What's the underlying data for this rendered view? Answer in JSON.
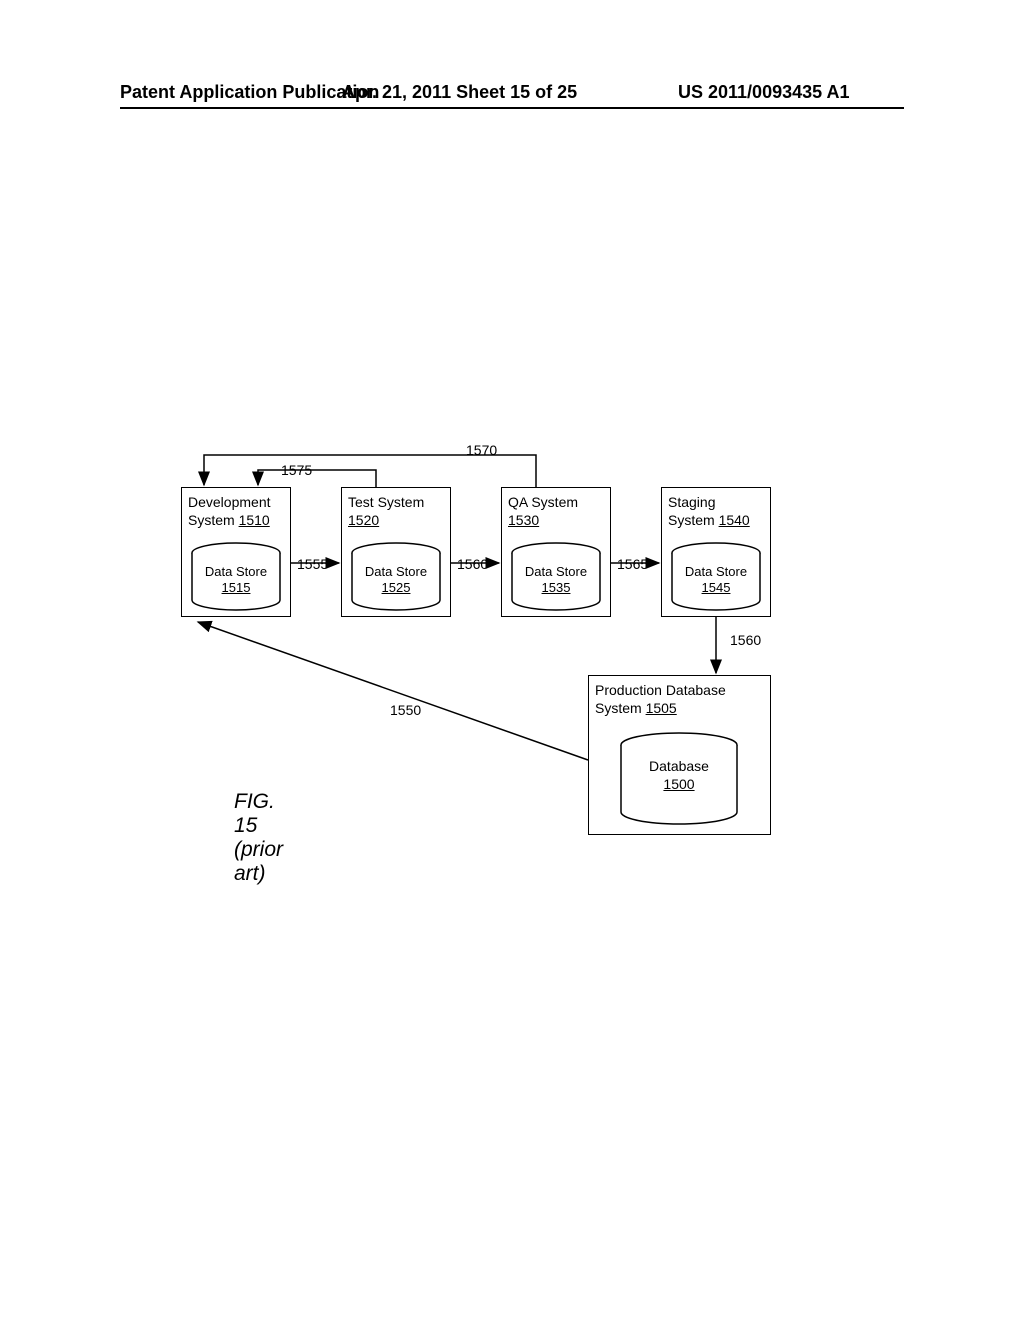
{
  "header": {
    "left": "Patent Application Publication",
    "mid": "Apr. 21, 2011  Sheet 15 of 25",
    "right": "US 2011/0093435 A1"
  },
  "systems": {
    "dev": {
      "line1": "Development",
      "line2": "System ",
      "ref": "1510"
    },
    "test": {
      "line1": "Test System",
      "line2": "",
      "ref": "1520"
    },
    "qa": {
      "line1": "QA System",
      "line2": "",
      "ref": "1530"
    },
    "staging": {
      "line1": "Staging",
      "line2": "System ",
      "ref": "1540"
    },
    "prod": {
      "line1": "Production Database",
      "line2": "System ",
      "ref": "1505"
    }
  },
  "stores": {
    "dev": {
      "label": "Data Store",
      "ref": "1515"
    },
    "test": {
      "label": "Data Store",
      "ref": "1525"
    },
    "qa": {
      "label": "Data Store",
      "ref": "1535"
    },
    "staging": {
      "label": "Data Store",
      "ref": "1545"
    },
    "prod": {
      "label": "Database",
      "ref": "1500"
    }
  },
  "arrows": {
    "a1555": "1555",
    "a1560": "1560",
    "a1565": "1565",
    "a1560b": "1560",
    "a1550": "1550",
    "a1570": "1570",
    "a1575": "1575"
  },
  "caption": "FIG. 15 (prior art)"
}
